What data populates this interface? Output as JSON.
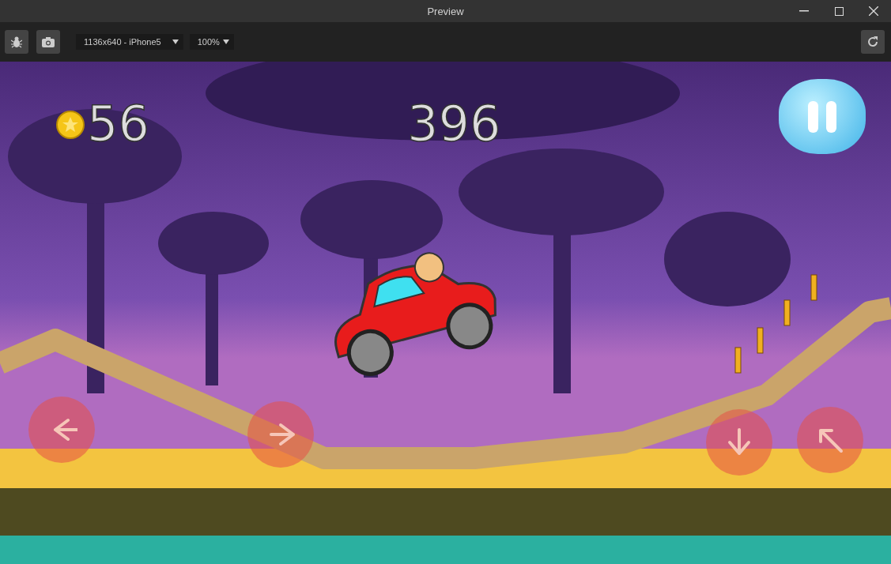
{
  "window": {
    "title": "Preview"
  },
  "toolbar": {
    "device": "1136x640 - iPhone5",
    "zoom": "100%"
  },
  "game": {
    "coins": "56",
    "score": "396"
  }
}
